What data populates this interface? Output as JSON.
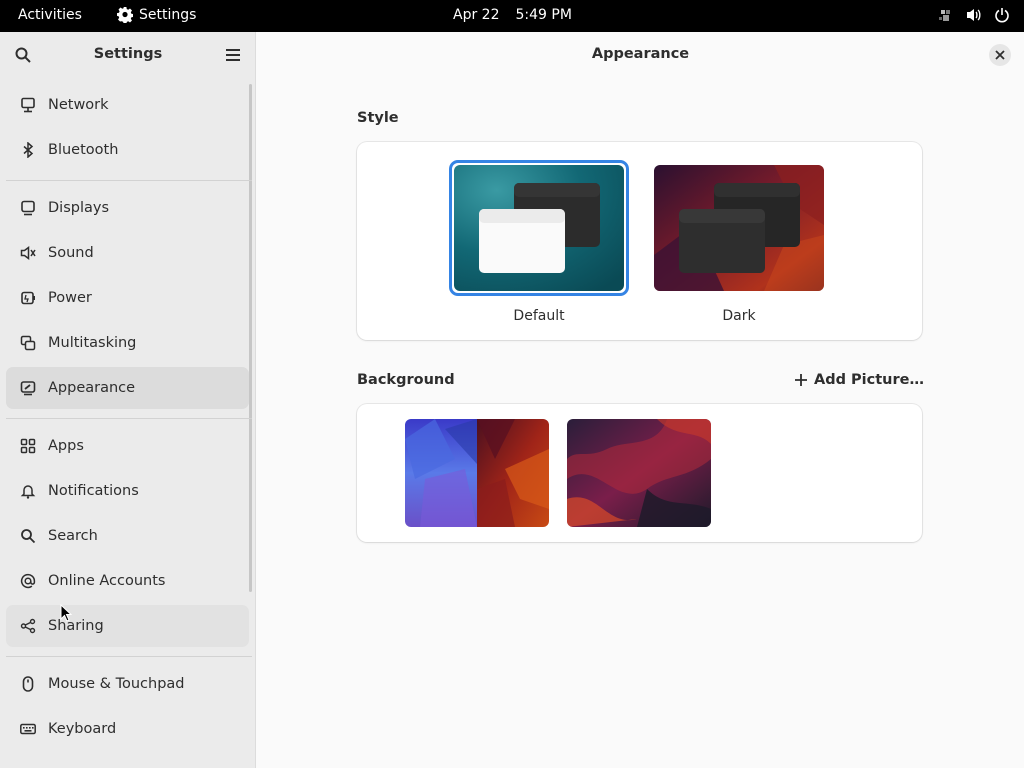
{
  "topbar": {
    "activities": "Activities",
    "app_name": "Settings",
    "date": "Apr 22",
    "time": "5:49 PM",
    "tray_icons": [
      "accessibility-icon",
      "volume-icon",
      "power-icon"
    ]
  },
  "sidebar": {
    "title": "Settings",
    "items": [
      {
        "label": "Network",
        "icon": "network-icon"
      },
      {
        "label": "Bluetooth",
        "icon": "bluetooth-icon"
      },
      {
        "label": "Displays",
        "icon": "display-icon"
      },
      {
        "label": "Sound",
        "icon": "sound-icon"
      },
      {
        "label": "Power",
        "icon": "power-plug-icon"
      },
      {
        "label": "Multitasking",
        "icon": "multitasking-icon"
      },
      {
        "label": "Appearance",
        "icon": "appearance-icon",
        "active": true
      },
      {
        "label": "Apps",
        "icon": "apps-grid-icon"
      },
      {
        "label": "Notifications",
        "icon": "bell-icon"
      },
      {
        "label": "Search",
        "icon": "search-icon"
      },
      {
        "label": "Online Accounts",
        "icon": "at-icon"
      },
      {
        "label": "Sharing",
        "icon": "share-icon",
        "hover": true
      },
      {
        "label": "Mouse & Touchpad",
        "icon": "mouse-icon"
      },
      {
        "label": "Keyboard",
        "icon": "keyboard-icon"
      }
    ]
  },
  "main": {
    "title": "Appearance",
    "style": {
      "label": "Style",
      "options": [
        {
          "label": "Default",
          "selected": true
        },
        {
          "label": "Dark",
          "selected": false
        }
      ]
    },
    "background": {
      "label": "Background",
      "add_label": "Add Picture…",
      "thumbnails": [
        "blue-red-polygon-wallpaper",
        "dark-red-wave-wallpaper"
      ]
    }
  },
  "colors": {
    "accent": "#3584e4",
    "topbar": "#000000",
    "sidebar": "#ebebeb",
    "active_item": "#dcdcdc"
  }
}
